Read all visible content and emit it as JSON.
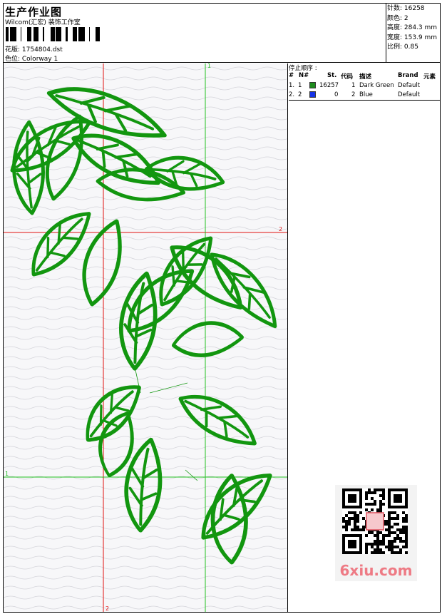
{
  "header": {
    "title": "生产作业图",
    "company": "Wilcom(汇宏) 装饰工作室",
    "design_label": "花版: 1754804.dst",
    "colorway_label": "色位: Colorway 1"
  },
  "stats": [
    "针数: 16258",
    "颜色: 2",
    "高度: 284.3 mm",
    "宽度: 153.9 mm",
    "比例: 0.85"
  ],
  "stop_sequence": {
    "title": "停止顺序 :",
    "headers": [
      "#",
      "N#",
      "St.",
      "代码",
      "描述",
      "Brand",
      "元素"
    ],
    "rows": [
      {
        "index": "1.",
        "n": "1",
        "stitches": "16257",
        "code": "1",
        "description": "Dark Green",
        "brand": "Default",
        "color": "#1e8c1e"
      },
      {
        "index": "2.",
        "n": "2",
        "stitches": "0",
        "code": "2",
        "description": "Blue",
        "brand": "Default",
        "color": "#1432e6"
      }
    ]
  },
  "guides": {
    "green_label_top": "1",
    "green_label_left": "1",
    "red_label_right": "2",
    "red_label_bottom": "2"
  },
  "watermark": {
    "text": "6xiu.com"
  },
  "colors": {
    "embroidery": "#12960f",
    "guide_red": "#e01010",
    "guide_green": "#20c020"
  }
}
